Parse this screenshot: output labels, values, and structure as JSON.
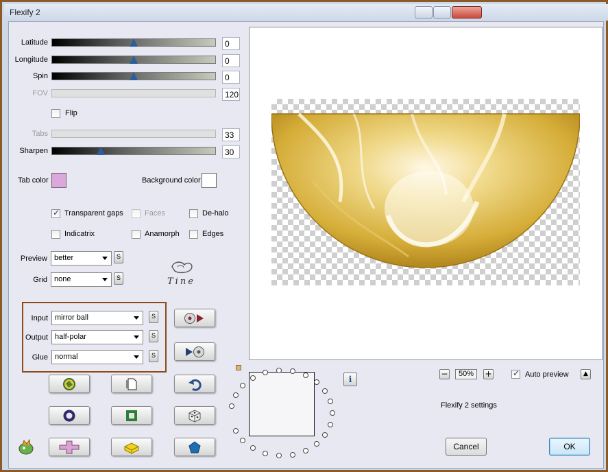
{
  "window": {
    "title": "Flexify 2"
  },
  "controls": {
    "latitude": {
      "label": "Latitude",
      "value": "0",
      "level": 0.5
    },
    "longitude": {
      "label": "Longitude",
      "value": "0",
      "level": 0.5
    },
    "spin": {
      "label": "Spin",
      "value": "0",
      "level": 0.5
    },
    "fov": {
      "label": "FOV",
      "value": "120",
      "level": 0
    },
    "flip": {
      "label": "Flip",
      "checked": false
    },
    "tabs": {
      "label": "Tabs",
      "value": "33",
      "level": 0
    },
    "sharpen": {
      "label": "Sharpen",
      "value": "30",
      "level": 0.3
    }
  },
  "colors": {
    "tab_color": {
      "label": "Tab color",
      "value": "#dca8dc"
    },
    "background_color": {
      "label": "Background color",
      "value": "#ffffff"
    }
  },
  "options": {
    "transparent_gaps": {
      "label": "Transparent gaps",
      "checked": true
    },
    "faces": {
      "label": "Faces",
      "checked": false,
      "disabled": true
    },
    "de_halo": {
      "label": "De-halo",
      "checked": false
    },
    "indicatrix": {
      "label": "Indicatrix",
      "checked": false
    },
    "anamorph": {
      "label": "Anamorph",
      "checked": false
    },
    "edges": {
      "label": "Edges",
      "checked": false
    }
  },
  "dropdowns": {
    "preview": {
      "label": "Preview",
      "value": "better"
    },
    "grid": {
      "label": "Grid",
      "value": "none"
    },
    "input": {
      "label": "Input",
      "value": "mirror ball"
    },
    "output": {
      "label": "Output",
      "value": "half-polar"
    },
    "glue": {
      "label": "Glue",
      "value": "normal"
    }
  },
  "s_button_label": "S",
  "signature_text": "Tine",
  "zoom": {
    "value": "50%",
    "minus": "−",
    "plus": "+"
  },
  "auto_preview": {
    "label": "Auto preview",
    "checked": true
  },
  "settings_name": "Flexify 2 settings",
  "info_label": "i",
  "buttons": {
    "cancel": "Cancel",
    "ok": "OK"
  },
  "icons": [
    "globe-icon",
    "page-icon",
    "undo-icon",
    "ring-icon",
    "green-square-icon",
    "dice-icon",
    "plugin-logo-icon",
    "pink-cross-icon",
    "yellow-brick-icon",
    "pentagon-icon",
    "cd-right-icon",
    "cd-left-icon"
  ],
  "accent_color": "#8b4a16"
}
